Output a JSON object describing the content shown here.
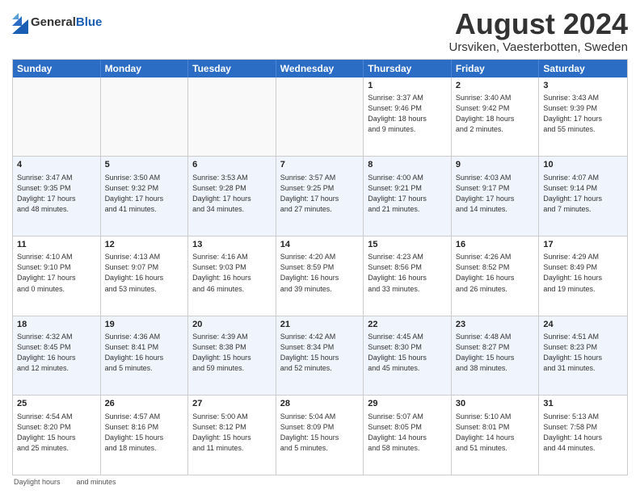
{
  "header": {
    "logo_general": "General",
    "logo_blue": "Blue",
    "main_title": "August 2024",
    "subtitle": "Ursviken, Vaesterbotten, Sweden"
  },
  "calendar": {
    "days_of_week": [
      "Sunday",
      "Monday",
      "Tuesday",
      "Wednesday",
      "Thursday",
      "Friday",
      "Saturday"
    ],
    "rows": [
      {
        "alt": false,
        "cells": [
          {
            "day": "",
            "text": ""
          },
          {
            "day": "",
            "text": ""
          },
          {
            "day": "",
            "text": ""
          },
          {
            "day": "",
            "text": ""
          },
          {
            "day": "1",
            "text": "Sunrise: 3:37 AM\nSunset: 9:46 PM\nDaylight: 18 hours\nand 9 minutes."
          },
          {
            "day": "2",
            "text": "Sunrise: 3:40 AM\nSunset: 9:42 PM\nDaylight: 18 hours\nand 2 minutes."
          },
          {
            "day": "3",
            "text": "Sunrise: 3:43 AM\nSunset: 9:39 PM\nDaylight: 17 hours\nand 55 minutes."
          }
        ]
      },
      {
        "alt": true,
        "cells": [
          {
            "day": "4",
            "text": "Sunrise: 3:47 AM\nSunset: 9:35 PM\nDaylight: 17 hours\nand 48 minutes."
          },
          {
            "day": "5",
            "text": "Sunrise: 3:50 AM\nSunset: 9:32 PM\nDaylight: 17 hours\nand 41 minutes."
          },
          {
            "day": "6",
            "text": "Sunrise: 3:53 AM\nSunset: 9:28 PM\nDaylight: 17 hours\nand 34 minutes."
          },
          {
            "day": "7",
            "text": "Sunrise: 3:57 AM\nSunset: 9:25 PM\nDaylight: 17 hours\nand 27 minutes."
          },
          {
            "day": "8",
            "text": "Sunrise: 4:00 AM\nSunset: 9:21 PM\nDaylight: 17 hours\nand 21 minutes."
          },
          {
            "day": "9",
            "text": "Sunrise: 4:03 AM\nSunset: 9:17 PM\nDaylight: 17 hours\nand 14 minutes."
          },
          {
            "day": "10",
            "text": "Sunrise: 4:07 AM\nSunset: 9:14 PM\nDaylight: 17 hours\nand 7 minutes."
          }
        ]
      },
      {
        "alt": false,
        "cells": [
          {
            "day": "11",
            "text": "Sunrise: 4:10 AM\nSunset: 9:10 PM\nDaylight: 17 hours\nand 0 minutes."
          },
          {
            "day": "12",
            "text": "Sunrise: 4:13 AM\nSunset: 9:07 PM\nDaylight: 16 hours\nand 53 minutes."
          },
          {
            "day": "13",
            "text": "Sunrise: 4:16 AM\nSunset: 9:03 PM\nDaylight: 16 hours\nand 46 minutes."
          },
          {
            "day": "14",
            "text": "Sunrise: 4:20 AM\nSunset: 8:59 PM\nDaylight: 16 hours\nand 39 minutes."
          },
          {
            "day": "15",
            "text": "Sunrise: 4:23 AM\nSunset: 8:56 PM\nDaylight: 16 hours\nand 33 minutes."
          },
          {
            "day": "16",
            "text": "Sunrise: 4:26 AM\nSunset: 8:52 PM\nDaylight: 16 hours\nand 26 minutes."
          },
          {
            "day": "17",
            "text": "Sunrise: 4:29 AM\nSunset: 8:49 PM\nDaylight: 16 hours\nand 19 minutes."
          }
        ]
      },
      {
        "alt": true,
        "cells": [
          {
            "day": "18",
            "text": "Sunrise: 4:32 AM\nSunset: 8:45 PM\nDaylight: 16 hours\nand 12 minutes."
          },
          {
            "day": "19",
            "text": "Sunrise: 4:36 AM\nSunset: 8:41 PM\nDaylight: 16 hours\nand 5 minutes."
          },
          {
            "day": "20",
            "text": "Sunrise: 4:39 AM\nSunset: 8:38 PM\nDaylight: 15 hours\nand 59 minutes."
          },
          {
            "day": "21",
            "text": "Sunrise: 4:42 AM\nSunset: 8:34 PM\nDaylight: 15 hours\nand 52 minutes."
          },
          {
            "day": "22",
            "text": "Sunrise: 4:45 AM\nSunset: 8:30 PM\nDaylight: 15 hours\nand 45 minutes."
          },
          {
            "day": "23",
            "text": "Sunrise: 4:48 AM\nSunset: 8:27 PM\nDaylight: 15 hours\nand 38 minutes."
          },
          {
            "day": "24",
            "text": "Sunrise: 4:51 AM\nSunset: 8:23 PM\nDaylight: 15 hours\nand 31 minutes."
          }
        ]
      },
      {
        "alt": false,
        "cells": [
          {
            "day": "25",
            "text": "Sunrise: 4:54 AM\nSunset: 8:20 PM\nDaylight: 15 hours\nand 25 minutes."
          },
          {
            "day": "26",
            "text": "Sunrise: 4:57 AM\nSunset: 8:16 PM\nDaylight: 15 hours\nand 18 minutes."
          },
          {
            "day": "27",
            "text": "Sunrise: 5:00 AM\nSunset: 8:12 PM\nDaylight: 15 hours\nand 11 minutes."
          },
          {
            "day": "28",
            "text": "Sunrise: 5:04 AM\nSunset: 8:09 PM\nDaylight: 15 hours\nand 5 minutes."
          },
          {
            "day": "29",
            "text": "Sunrise: 5:07 AM\nSunset: 8:05 PM\nDaylight: 14 hours\nand 58 minutes."
          },
          {
            "day": "30",
            "text": "Sunrise: 5:10 AM\nSunset: 8:01 PM\nDaylight: 14 hours\nand 51 minutes."
          },
          {
            "day": "31",
            "text": "Sunrise: 5:13 AM\nSunset: 7:58 PM\nDaylight: 14 hours\nand 44 minutes."
          }
        ]
      }
    ]
  },
  "footer": {
    "note1": "Daylight hours",
    "note2": "and minutes"
  }
}
